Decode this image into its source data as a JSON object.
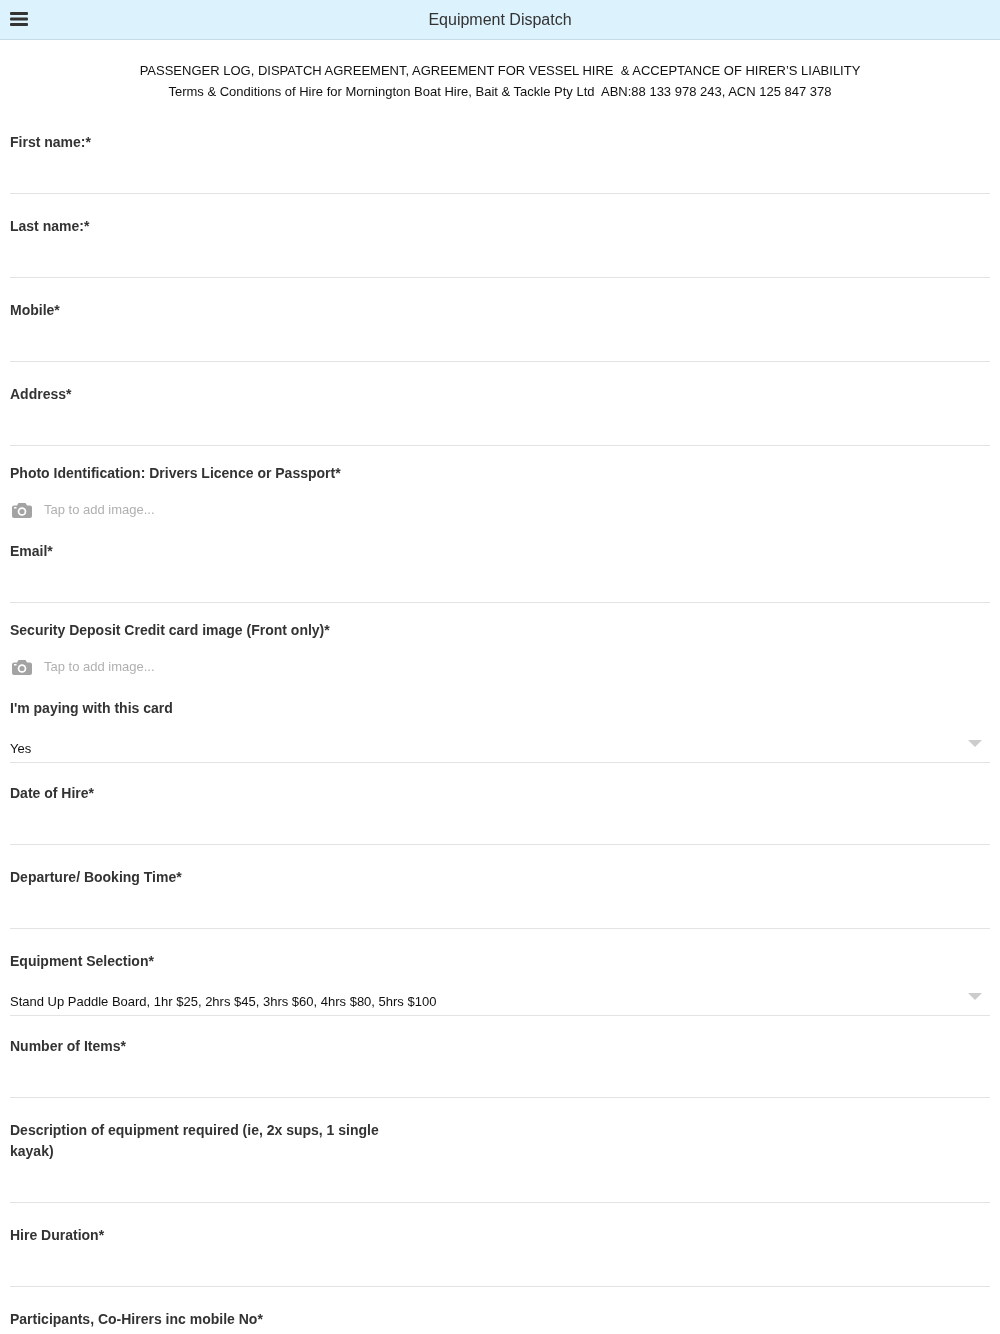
{
  "header": {
    "title": "Equipment Dispatch"
  },
  "intro": {
    "heading": "PASSENGER LOG, DISPATCH AGREEMENT, AGREEMENT FOR VESSEL HIRE  & ACCEPTANCE OF HIRER’S LIABILITY",
    "terms": "Terms & Conditions of Hire for Mornington Boat Hire, Bait & Tackle Pty Ltd  ABN:88 133 978 243, ACN 125 847 378"
  },
  "fields": [
    {
      "kind": "text",
      "label": "First name:*"
    },
    {
      "kind": "text",
      "label": "Last name:*"
    },
    {
      "kind": "text",
      "label": "Mobile*"
    },
    {
      "kind": "text",
      "label": "Address*"
    },
    {
      "kind": "image",
      "label": "Photo Identification: Drivers Licence or Passport*",
      "placeholder": "Tap to add image..."
    },
    {
      "kind": "text",
      "label": "Email*"
    },
    {
      "kind": "image",
      "label": "Security Deposit Credit card image (Front only)*",
      "placeholder": "Tap to add image..."
    },
    {
      "kind": "select",
      "label": "I'm paying with this card",
      "value": "Yes"
    },
    {
      "kind": "text",
      "label": "Date of Hire*"
    },
    {
      "kind": "text",
      "label": "Departure/ Booking Time*"
    },
    {
      "kind": "select",
      "label": "Equipment Selection*",
      "value": "Stand Up Paddle Board, 1hr $25, 2hrs $45, 3hrs $60, 4hrs $80, 5hrs $100"
    },
    {
      "kind": "text",
      "label": "Number of Items*"
    },
    {
      "kind": "text",
      "label": "Description of equipment required (ie, 2x sups, 1 single kayak)"
    },
    {
      "kind": "text",
      "label": "Hire Duration*"
    },
    {
      "kind": "text",
      "label": "Participants, Co-Hirers inc mobile No*"
    }
  ]
}
